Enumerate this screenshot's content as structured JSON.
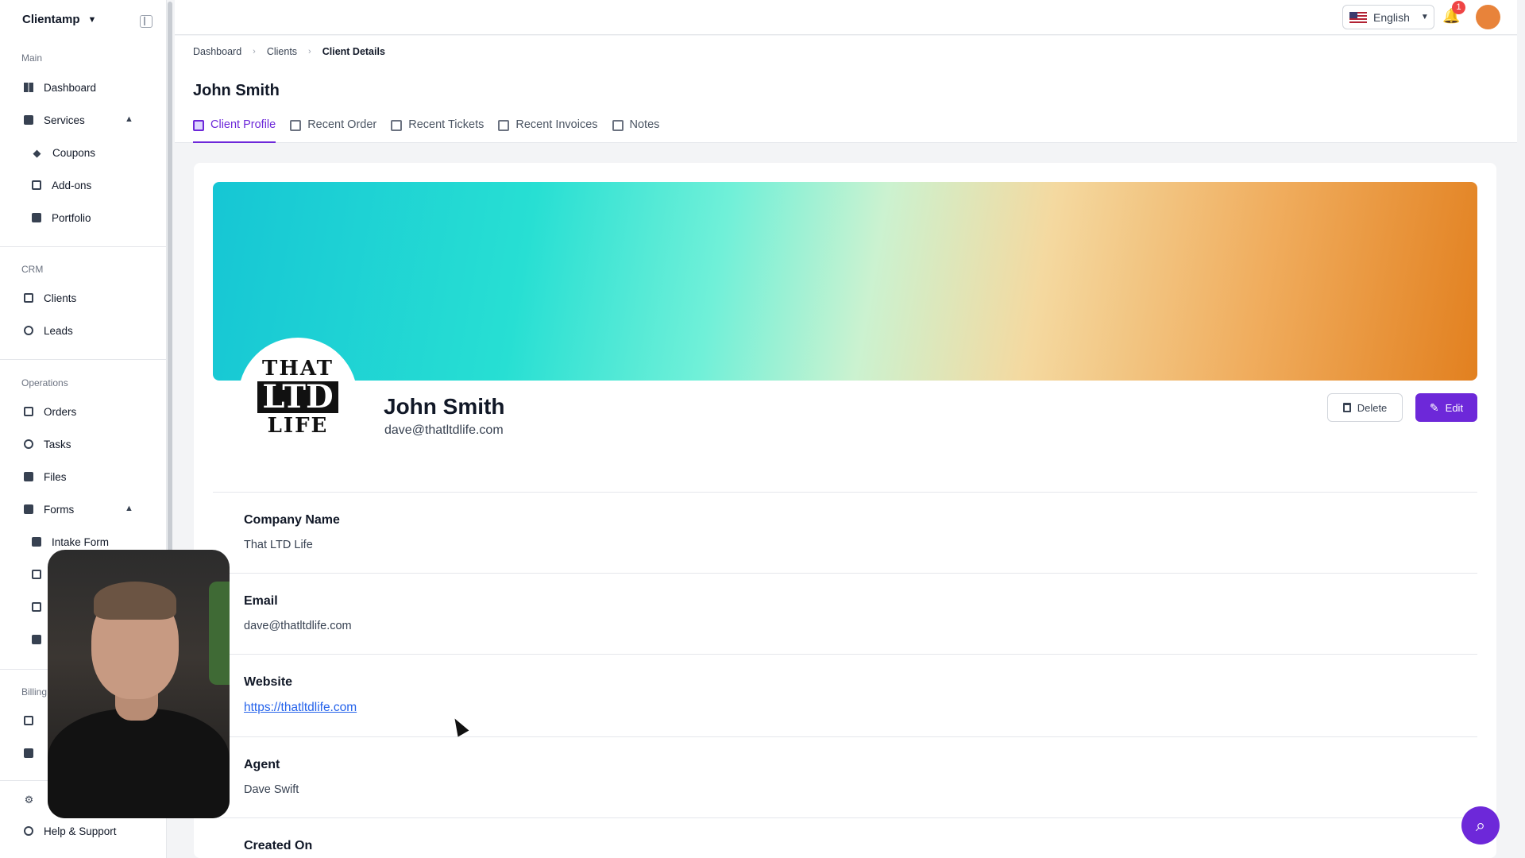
{
  "app": {
    "name": "Clientamp"
  },
  "sidebar": {
    "sections": [
      "Main",
      "CRM",
      "Operations",
      "Billing"
    ],
    "items": {
      "dashboard": "Dashboard",
      "services": "Services",
      "coupons": "Coupons",
      "addons": "Add-ons",
      "portfolio": "Portfolio",
      "clients": "Clients",
      "leads": "Leads",
      "orders": "Orders",
      "tasks": "Tasks",
      "files": "Files",
      "forms": "Forms",
      "intake_form": "Intake Form",
      "help": "Help & Support"
    }
  },
  "topbar": {
    "language": "English",
    "notification_count": "1"
  },
  "breadcrumb": [
    "Dashboard",
    "Clients",
    "Client Details"
  ],
  "page": {
    "title": "John Smith"
  },
  "tabs": [
    "Client Profile",
    "Recent Order",
    "Recent Tickets",
    "Recent Invoices",
    "Notes"
  ],
  "profile": {
    "logo_text": [
      "THAT",
      "LTD",
      "LIFE"
    ],
    "name": "John Smith",
    "email": "dave@thatltdlife.com",
    "delete_label": "Delete",
    "edit_label": "Edit"
  },
  "fields": [
    {
      "label": "Company Name",
      "value": "That LTD Life"
    },
    {
      "label": "Email",
      "value": "dave@thatltdlife.com"
    },
    {
      "label": "Website",
      "value": "https://thatltdlife.com"
    },
    {
      "label": "Agent",
      "value": "Dave Swift"
    },
    {
      "label": "Created On",
      "value": ""
    }
  ],
  "colors": {
    "accent": "#6d28d9",
    "link": "#2563eb",
    "badge": "#ef4444"
  }
}
